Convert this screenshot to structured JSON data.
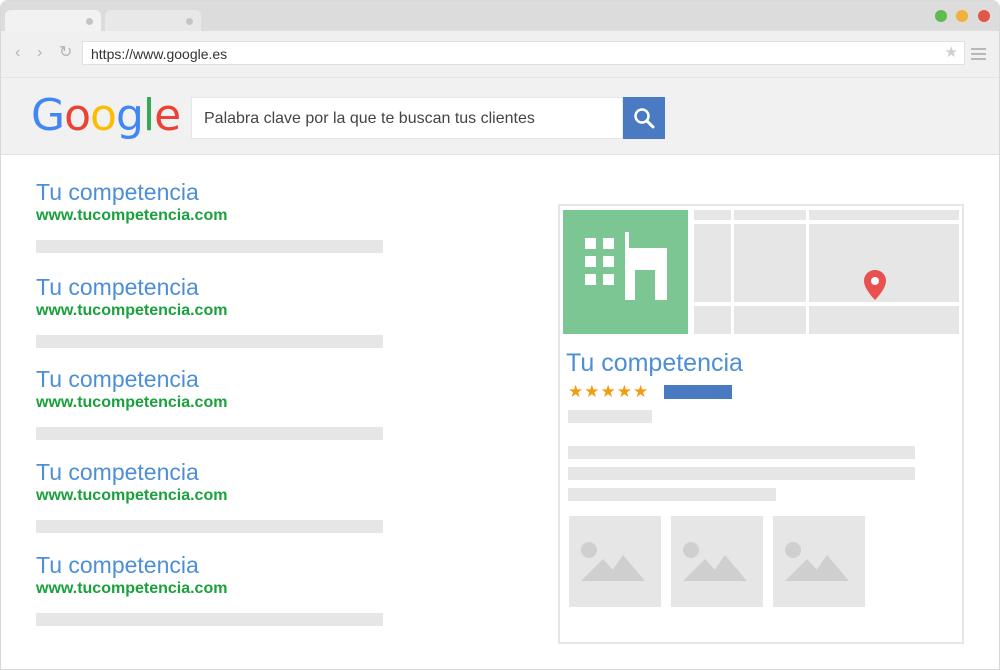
{
  "browser": {
    "url": "https://www.google.es",
    "colors": {
      "close": "#e2574c",
      "minimize": "#f0b23a",
      "maximize": "#5fbb4e"
    }
  },
  "google": {
    "logo_letters": [
      {
        "char": "G",
        "color": "#4285f4"
      },
      {
        "char": "o",
        "color": "#ea4335"
      },
      {
        "char": "o",
        "color": "#fbbc05"
      },
      {
        "char": "g",
        "color": "#4285f4"
      },
      {
        "char": "l",
        "color": "#34a853"
      },
      {
        "char": "e",
        "color": "#ea4335"
      }
    ],
    "search_query": "Palabra clave por la que te buscan tus clientes"
  },
  "results": [
    {
      "title": "Tu competencia",
      "url": "www.tucompetencia.com"
    },
    {
      "title": "Tu competencia",
      "url": "www.tucompetencia.com"
    },
    {
      "title": "Tu competencia",
      "url": "www.tucompetencia.com"
    },
    {
      "title": "Tu competencia",
      "url": "www.tucompetencia.com"
    },
    {
      "title": "Tu competencia",
      "url": "www.tucompetencia.com"
    }
  ],
  "panel": {
    "title": "Tu competencia",
    "stars": "★★★★★",
    "rating": 5,
    "photo_icon": "building-icon",
    "map_icon": "map-pin-icon"
  }
}
